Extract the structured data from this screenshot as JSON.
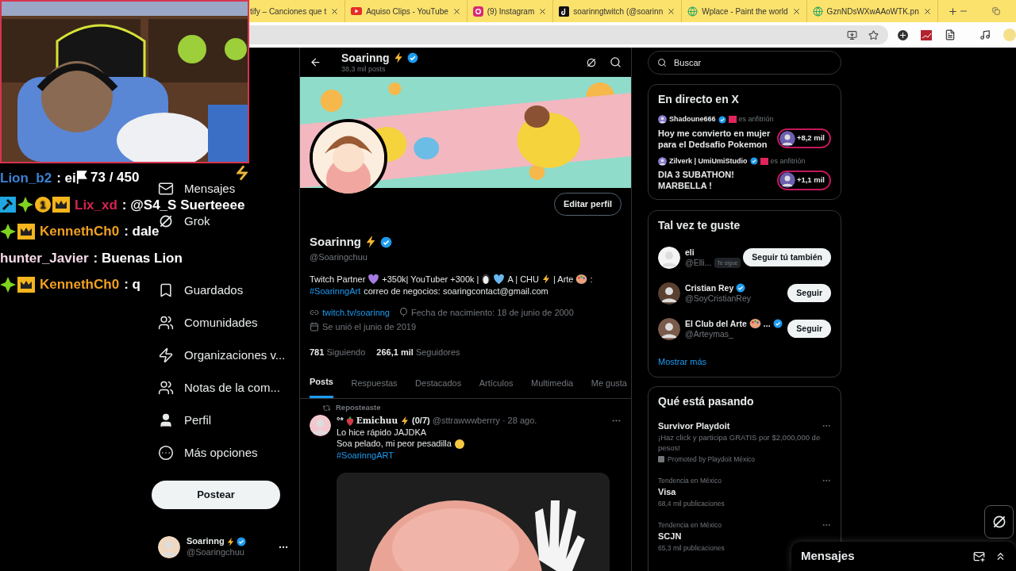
{
  "browser": {
    "tabs": [
      {
        "title": "tify – Canciones que t",
        "kind": "plain"
      },
      {
        "title": "Aquiso Clips - YouTube",
        "kind": "video"
      },
      {
        "title": "(9) Instagram",
        "kind": "camera"
      },
      {
        "title": "soarinngtwitch (@soarinn",
        "kind": "note"
      },
      {
        "title": "Wplace - Paint the world",
        "kind": "web"
      },
      {
        "title": "GznNDsWXwAAoWTK.pn",
        "kind": "web"
      }
    ]
  },
  "stream_overlay": {
    "goal_counter": "73 / 450",
    "chat": [
      {
        "user": "Lion_b2",
        "color": "#3b82d6",
        "message": ": ei"
      },
      {
        "user": "Lix_xd",
        "color": "#d6234f",
        "message": ": @S4_S Suerteeee",
        "badges": [
          {
            "kind": "hammer"
          },
          {
            "kind": "gem"
          },
          {
            "kind": "tier",
            "label": "1"
          },
          {
            "kind": "crown"
          }
        ]
      },
      {
        "user": "KennethCh0",
        "color": "#f0a020",
        "message": ": dale",
        "badges": [
          {
            "kind": "gem"
          },
          {
            "kind": "crown"
          }
        ]
      },
      {
        "user": "hunter_Javier",
        "color": "#f5d9e8",
        "message": ": Buenas Lion"
      },
      {
        "user": "KennethCh0",
        "color": "#f0a020",
        "message": ": q",
        "badges": [
          {
            "kind": "gem"
          },
          {
            "kind": "crown"
          }
        ]
      }
    ]
  },
  "sidebar": {
    "nav_upper": [
      {
        "label": "Mensajes"
      },
      {
        "label": "Grok"
      }
    ],
    "nav_lower": [
      {
        "label": "Guardados"
      },
      {
        "label": "Comunidades"
      },
      {
        "label": "Organizaciones v..."
      },
      {
        "label": "Notas de la com..."
      },
      {
        "label": "Perfil"
      },
      {
        "label": "Más opciones"
      }
    ],
    "post_button": "Postear",
    "account": {
      "name": "Soarinng",
      "verified": true,
      "handle": "@Soaringchuu"
    }
  },
  "profile": {
    "header_name": "Soarinng",
    "header_posts": "38,3 mil posts",
    "edit_button": "Editar perfil",
    "name": "Soarinng",
    "verified": true,
    "handle": "@Soaringchuu",
    "bio_line_1": [
      "Twitch Partner",
      "+350k| YouTuber +300k |",
      "A | CHU",
      "| Arte",
      ":"
    ],
    "bio_hashtag": "#SoarinngArt",
    "bio_rest": "correo de negocios: soaringcontact@gmail.com",
    "link": "twitch.tv/soarinng",
    "birthday": "Fecha de nacimiento: 18 de junio de 2000",
    "joined": "Se unió el junio de 2019",
    "following_count": "781",
    "following_label": "Siguiendo",
    "followers_count": "266,1 mil",
    "followers_label": "Seguidores",
    "tabs": [
      {
        "label": "Posts",
        "selected": true
      },
      {
        "label": "Respuestas",
        "selected": false
      },
      {
        "label": "Destacados",
        "selected": false
      },
      {
        "label": "Artículos",
        "selected": false
      },
      {
        "label": "Multimedia",
        "selected": false
      },
      {
        "label": "Me gusta",
        "selected": false
      }
    ],
    "post": {
      "repost_label": "Reposteaste",
      "author_prefix": "°*",
      "author": "Emichuu",
      "author_suffix": "(0/7)",
      "handle_time": "@sttrawwwberrry · 28 ago.",
      "lines": [
        "Lo hice rápido JAJDKA",
        "Soa pelado, mi peor pesadilla"
      ],
      "hashtag": "#SoarinngART"
    }
  },
  "right": {
    "search_placeholder": "Buscar",
    "live": {
      "title": "En directo en X",
      "items": [
        {
          "host": "Shadoune666",
          "verified": true,
          "host_label": "es anfitrión",
          "title": "Hoy me convierto en mujer para el Dedsafio Pokemon",
          "listeners": "+8,2 mil"
        },
        {
          "host": "Zilverk | UmiUmiStudio",
          "verified": true,
          "host_label": "es anfitrión",
          "title": "DIA 3 SUBATHON! MARBELLA !",
          "listeners": "+1,1 mil"
        }
      ]
    },
    "suggest": {
      "title": "Tal vez te guste",
      "items": [
        {
          "name": "eli",
          "verified": false,
          "palette": false,
          "handle": "@Elli...",
          "follows_you": "Te sigue",
          "button": "Seguir tú también"
        },
        {
          "name": "Cristian Rey",
          "verified": true,
          "palette": false,
          "handle": "@SoyCristianRey",
          "button": "Seguir"
        },
        {
          "name": "El Club del Arte",
          "verified": true,
          "palette": true,
          "tail": "...",
          "handle": "@Arteymas_",
          "button": "Seguir"
        }
      ],
      "more": "Mostrar más"
    },
    "trends": {
      "title": "Qué está pasando",
      "items": [
        {
          "kind": "promoted",
          "name": "Survivor Playdoit",
          "text": "¡Haz click y participa GRATIS por $2,000,000 de pesos!",
          "footer": "Promoted by Playdoit México"
        },
        {
          "kind": "trend",
          "context": "Tendencia en México",
          "name": "Visa",
          "footer": "68,4 mil publicaciones"
        },
        {
          "kind": "trend",
          "context": "Tendencia en México",
          "name": "SCJN",
          "footer": "65,3 mil publicaciones"
        }
      ]
    },
    "messages_drawer": "Mensajes"
  }
}
